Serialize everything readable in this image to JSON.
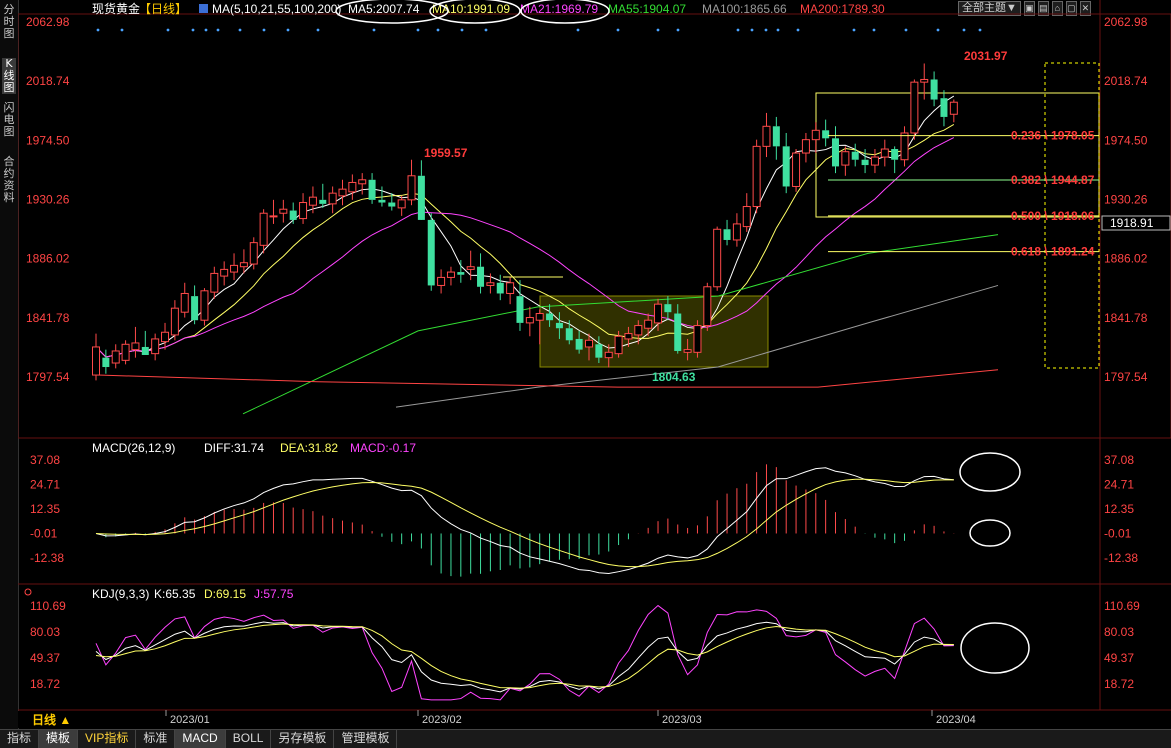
{
  "left_tabs": [
    "分时图",
    "K线图",
    "闪电图",
    "合约资料"
  ],
  "header": {
    "symbol": "现货黄金",
    "period": "【日线】",
    "ma_label": "MA(5,10,21,55,100,200)",
    "ma": [
      {
        "label": "MA5:2007.74",
        "color": "#ffffff"
      },
      {
        "label": "MA10:1991.09",
        "color": "#ffff66"
      },
      {
        "label": "MA21:1969.79",
        "color": "#ff44ff"
      },
      {
        "label": "MA55:1904.07",
        "color": "#33dd33"
      },
      {
        "label": "MA100:1865.66",
        "color": "#9a9a9a"
      },
      {
        "label": "MA200:1789.30",
        "color": "#ff4444"
      }
    ],
    "theme_button": "全部主题▼",
    "window_buttons": [
      "▣",
      "▤",
      "⌂",
      "▢",
      "✕"
    ]
  },
  "price_axis": [
    "2062.98",
    "2018.74",
    "1974.50",
    "1930.26",
    "1886.02",
    "1841.78",
    "1797.54"
  ],
  "price_axis_highlight": "1918.91",
  "annotations": {
    "high1": "1959.57",
    "low": "1804.63",
    "high2": "2031.97"
  },
  "fib_levels": [
    {
      "label": "0.236 \\ 1978.05",
      "price": 1978.05
    },
    {
      "label": "0.382 \\ 1944.87",
      "price": 1944.87
    },
    {
      "label": "0.500 \\ 1918.06",
      "price": 1918.06
    },
    {
      "label": "0.618 \\ 1891.24",
      "price": 1891.24
    }
  ],
  "macd": {
    "title": "MACD(26,12,9)",
    "diff": "DIFF:31.74",
    "dea": "DEA:31.82",
    "macd": "MACD:-0.17",
    "axis": [
      "37.08",
      "24.71",
      "12.35",
      "-0.01",
      "-12.38"
    ]
  },
  "kdj": {
    "title": "KDJ(9,3,3)",
    "k": "K:65.35",
    "d": "D:69.15",
    "j": "J:57.75",
    "axis": [
      "110.69",
      "80.03",
      "49.37",
      "18.72"
    ]
  },
  "date_axis": {
    "period_label": "日线 ▲",
    "dates": [
      "2023/01",
      "2023/02",
      "2023/03",
      "2023/04"
    ]
  },
  "bottom_tabs": [
    {
      "label": "指标",
      "active": false
    },
    {
      "label": "模板",
      "active": true
    },
    {
      "label": "VIP指标",
      "active": false,
      "vip": true
    },
    {
      "label": "标准",
      "active": false
    },
    {
      "label": "MACD",
      "active": true
    },
    {
      "label": "BOLL",
      "active": false
    },
    {
      "label": "另存模板",
      "active": false
    },
    {
      "label": "管理模板",
      "active": false
    }
  ],
  "colors": {
    "up": "#ff4a4a",
    "down": "#3fe0a0",
    "fib": "#ffff00",
    "text_red": "#ff3b3b"
  },
  "chart_data": {
    "type": "candlestick",
    "x": [
      "2022-12-30",
      "2023-04-06"
    ],
    "y_range": [
      1780,
      2072
    ],
    "candles": [
      {
        "o": 1799,
        "h": 1830,
        "l": 1795,
        "c": 1820
      },
      {
        "o": 1812,
        "h": 1818,
        "l": 1800,
        "c": 1805
      },
      {
        "o": 1808,
        "h": 1822,
        "l": 1804,
        "c": 1817
      },
      {
        "o": 1810,
        "h": 1825,
        "l": 1807,
        "c": 1822
      },
      {
        "o": 1818,
        "h": 1835,
        "l": 1812,
        "c": 1823
      },
      {
        "o": 1820,
        "h": 1832,
        "l": 1815,
        "c": 1814
      },
      {
        "o": 1815,
        "h": 1830,
        "l": 1810,
        "c": 1826
      },
      {
        "o": 1824,
        "h": 1838,
        "l": 1818,
        "c": 1831
      },
      {
        "o": 1829,
        "h": 1855,
        "l": 1825,
        "c": 1849
      },
      {
        "o": 1846,
        "h": 1868,
        "l": 1842,
        "c": 1860
      },
      {
        "o": 1858,
        "h": 1866,
        "l": 1837,
        "c": 1840
      },
      {
        "o": 1840,
        "h": 1864,
        "l": 1836,
        "c": 1862
      },
      {
        "o": 1861,
        "h": 1880,
        "l": 1856,
        "c": 1875
      },
      {
        "o": 1873,
        "h": 1884,
        "l": 1866,
        "c": 1878
      },
      {
        "o": 1876,
        "h": 1890,
        "l": 1870,
        "c": 1881
      },
      {
        "o": 1880,
        "h": 1893,
        "l": 1875,
        "c": 1883
      },
      {
        "o": 1882,
        "h": 1902,
        "l": 1878,
        "c": 1898
      },
      {
        "o": 1896,
        "h": 1923,
        "l": 1890,
        "c": 1920
      },
      {
        "o": 1918,
        "h": 1930,
        "l": 1912,
        "c": 1918
      },
      {
        "o": 1920,
        "h": 1930,
        "l": 1913,
        "c": 1923
      },
      {
        "o": 1922,
        "h": 1928,
        "l": 1912,
        "c": 1915
      },
      {
        "o": 1916,
        "h": 1935,
        "l": 1912,
        "c": 1928
      },
      {
        "o": 1926,
        "h": 1940,
        "l": 1920,
        "c": 1932
      },
      {
        "o": 1930,
        "h": 1942,
        "l": 1924,
        "c": 1927
      },
      {
        "o": 1927,
        "h": 1940,
        "l": 1920,
        "c": 1935
      },
      {
        "o": 1933,
        "h": 1945,
        "l": 1926,
        "c": 1938
      },
      {
        "o": 1936,
        "h": 1949,
        "l": 1930,
        "c": 1943
      },
      {
        "o": 1942,
        "h": 1950,
        "l": 1934,
        "c": 1945
      },
      {
        "o": 1945,
        "h": 1950,
        "l": 1927,
        "c": 1930
      },
      {
        "o": 1930,
        "h": 1940,
        "l": 1925,
        "c": 1928
      },
      {
        "o": 1928,
        "h": 1935,
        "l": 1922,
        "c": 1925
      },
      {
        "o": 1924,
        "h": 1933,
        "l": 1918,
        "c": 1930
      },
      {
        "o": 1930,
        "h": 1960,
        "l": 1926,
        "c": 1948
      },
      {
        "o": 1948,
        "h": 1959.57,
        "l": 1938,
        "c": 1915
      },
      {
        "o": 1915,
        "h": 1920,
        "l": 1862,
        "c": 1866
      },
      {
        "o": 1866,
        "h": 1878,
        "l": 1860,
        "c": 1872
      },
      {
        "o": 1872,
        "h": 1880,
        "l": 1866,
        "c": 1876
      },
      {
        "o": 1876,
        "h": 1885,
        "l": 1868,
        "c": 1874
      },
      {
        "o": 1878,
        "h": 1892,
        "l": 1870,
        "c": 1880
      },
      {
        "o": 1880,
        "h": 1890,
        "l": 1860,
        "c": 1865
      },
      {
        "o": 1866,
        "h": 1875,
        "l": 1860,
        "c": 1868
      },
      {
        "o": 1868,
        "h": 1874,
        "l": 1855,
        "c": 1860
      },
      {
        "o": 1860,
        "h": 1872,
        "l": 1852,
        "c": 1868
      },
      {
        "o": 1858,
        "h": 1870,
        "l": 1832,
        "c": 1838
      },
      {
        "o": 1838,
        "h": 1850,
        "l": 1828,
        "c": 1842
      },
      {
        "o": 1840,
        "h": 1848,
        "l": 1822,
        "c": 1845
      },
      {
        "o": 1845,
        "h": 1852,
        "l": 1835,
        "c": 1840
      },
      {
        "o": 1838,
        "h": 1846,
        "l": 1826,
        "c": 1834
      },
      {
        "o": 1834,
        "h": 1840,
        "l": 1822,
        "c": 1825
      },
      {
        "o": 1826,
        "h": 1832,
        "l": 1815,
        "c": 1818
      },
      {
        "o": 1820,
        "h": 1830,
        "l": 1810,
        "c": 1825
      },
      {
        "o": 1822,
        "h": 1828,
        "l": 1808,
        "c": 1812
      },
      {
        "o": 1812,
        "h": 1822,
        "l": 1804.63,
        "c": 1816
      },
      {
        "o": 1815,
        "h": 1832,
        "l": 1812,
        "c": 1828
      },
      {
        "o": 1826,
        "h": 1835,
        "l": 1820,
        "c": 1830
      },
      {
        "o": 1829,
        "h": 1840,
        "l": 1822,
        "c": 1836
      },
      {
        "o": 1834,
        "h": 1845,
        "l": 1828,
        "c": 1840
      },
      {
        "o": 1838,
        "h": 1856,
        "l": 1832,
        "c": 1852
      },
      {
        "o": 1852,
        "h": 1858,
        "l": 1840,
        "c": 1846
      },
      {
        "o": 1845,
        "h": 1852,
        "l": 1815,
        "c": 1817
      },
      {
        "o": 1816,
        "h": 1826,
        "l": 1810,
        "c": 1818
      },
      {
        "o": 1816,
        "h": 1840,
        "l": 1812,
        "c": 1836
      },
      {
        "o": 1836,
        "h": 1868,
        "l": 1832,
        "c": 1865
      },
      {
        "o": 1865,
        "h": 1910,
        "l": 1862,
        "c": 1908
      },
      {
        "o": 1908,
        "h": 1915,
        "l": 1896,
        "c": 1900
      },
      {
        "o": 1900,
        "h": 1920,
        "l": 1895,
        "c": 1912
      },
      {
        "o": 1910,
        "h": 1935,
        "l": 1906,
        "c": 1925
      },
      {
        "o": 1925,
        "h": 1975,
        "l": 1920,
        "c": 1970
      },
      {
        "o": 1970,
        "h": 1995,
        "l": 1962,
        "c": 1985
      },
      {
        "o": 1985,
        "h": 1992,
        "l": 1960,
        "c": 1970
      },
      {
        "o": 1970,
        "h": 1980,
        "l": 1935,
        "c": 1940
      },
      {
        "o": 1940,
        "h": 1968,
        "l": 1936,
        "c": 1965
      },
      {
        "o": 1965,
        "h": 1980,
        "l": 1958,
        "c": 1975
      },
      {
        "o": 1975,
        "h": 1988,
        "l": 1965,
        "c": 1982
      },
      {
        "o": 1982,
        "h": 1990,
        "l": 1970,
        "c": 1976
      },
      {
        "o": 1976,
        "h": 1985,
        "l": 1950,
        "c": 1955
      },
      {
        "o": 1956,
        "h": 1970,
        "l": 1948,
        "c": 1966
      },
      {
        "o": 1966,
        "h": 1972,
        "l": 1955,
        "c": 1960
      },
      {
        "o": 1960,
        "h": 1968,
        "l": 1950,
        "c": 1956
      },
      {
        "o": 1956,
        "h": 1968,
        "l": 1950,
        "c": 1962
      },
      {
        "o": 1962,
        "h": 1975,
        "l": 1955,
        "c": 1968
      },
      {
        "o": 1968,
        "h": 1970,
        "l": 1950,
        "c": 1960
      },
      {
        "o": 1960,
        "h": 1985,
        "l": 1955,
        "c": 1980
      },
      {
        "o": 1980,
        "h": 2020,
        "l": 1975,
        "c": 2018
      },
      {
        "o": 2018,
        "h": 2031.97,
        "l": 2005,
        "c": 2020
      },
      {
        "o": 2020,
        "h": 2026,
        "l": 2000,
        "c": 2005
      },
      {
        "o": 2006,
        "h": 2012,
        "l": 1985,
        "c": 1992
      },
      {
        "o": 1994,
        "h": 2005,
        "l": 1988,
        "c": 2003
      }
    ]
  }
}
